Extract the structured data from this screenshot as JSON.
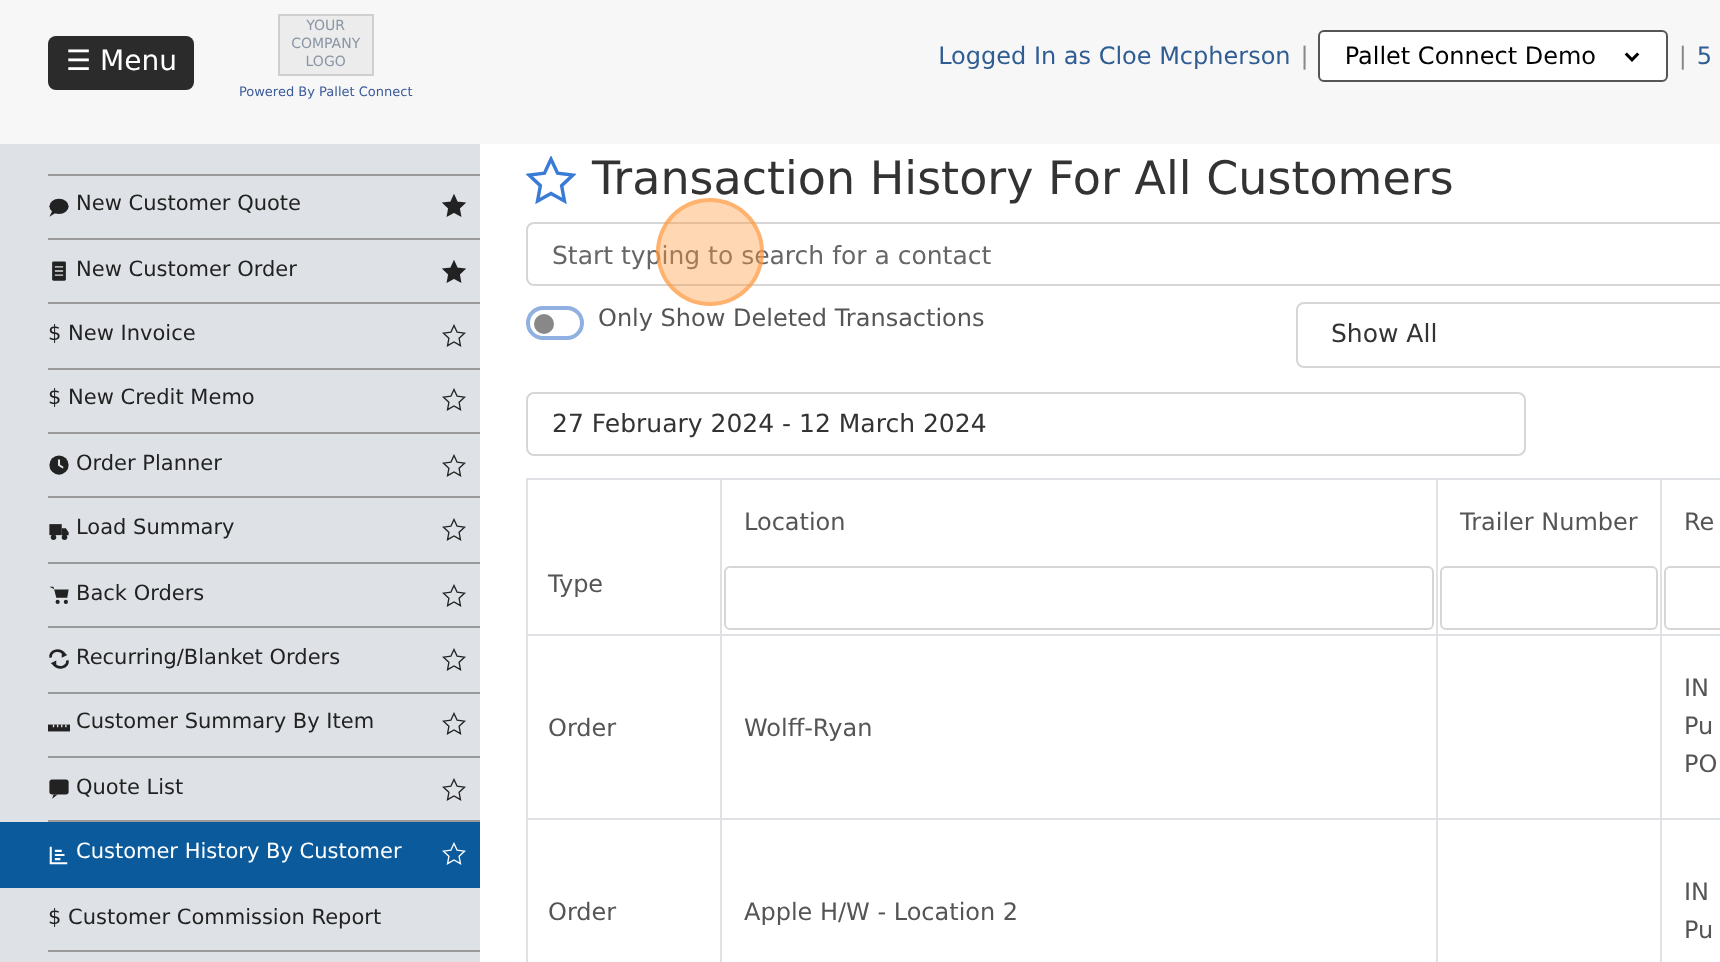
{
  "header": {
    "menu_button": "☰ Menu",
    "logo_text": [
      "YOUR",
      "COMPANY",
      "LOGO"
    ],
    "powered_by": "Powered By Pallet Connect",
    "logged_in": "Logged In as Cloe Mcpherson",
    "separator_1": "|",
    "company_select": "Pallet Connect Demo",
    "separator_2": "|",
    "cut_text": "5"
  },
  "sidebar": {
    "items": [
      {
        "label": "New Customer Quote",
        "starred": true,
        "selected": false
      },
      {
        "label": "New Customer Order",
        "starred": true,
        "selected": false
      },
      {
        "label": "$ New Invoice",
        "starred": false,
        "selected": false
      },
      {
        "label": "$ New Credit Memo",
        "starred": false,
        "selected": false
      },
      {
        "label": "Order Planner",
        "starred": false,
        "selected": false
      },
      {
        "label": "Load Summary",
        "starred": false,
        "selected": false
      },
      {
        "label": "Back Orders",
        "starred": false,
        "selected": false
      },
      {
        "label": "Recurring/Blanket Orders",
        "starred": false,
        "selected": false
      },
      {
        "label": "Customer Summary By Item",
        "starred": false,
        "selected": false
      },
      {
        "label": "Quote List",
        "starred": false,
        "selected": false
      },
      {
        "label": "Customer History By Customer",
        "starred": false,
        "selected": true
      },
      {
        "label": "$ Customer Commission Report",
        "selected": false
      }
    ]
  },
  "main": {
    "title": "Transaction History For All Customers",
    "favorite": false,
    "search": {
      "placeholder": "Start typing to search for a contact"
    },
    "deleted_toggle": {
      "label": "Only Show Deleted Transactions",
      "on": false
    },
    "filter_select": "Show All",
    "date_range": "27 February 2024 - 12 March 2024",
    "table": {
      "columns": [
        "Type",
        "Location",
        "Trailer Number",
        "Re"
      ],
      "rows": [
        {
          "cells": [
            "Order",
            "Wolff-Ryan",
            "",
            [
              "IN",
              "Pu",
              "PO"
            ]
          ]
        },
        {
          "cells": [
            "Order",
            "Apple H/W - Location 2",
            "",
            [
              "IN",
              "Pu"
            ]
          ]
        }
      ]
    }
  }
}
